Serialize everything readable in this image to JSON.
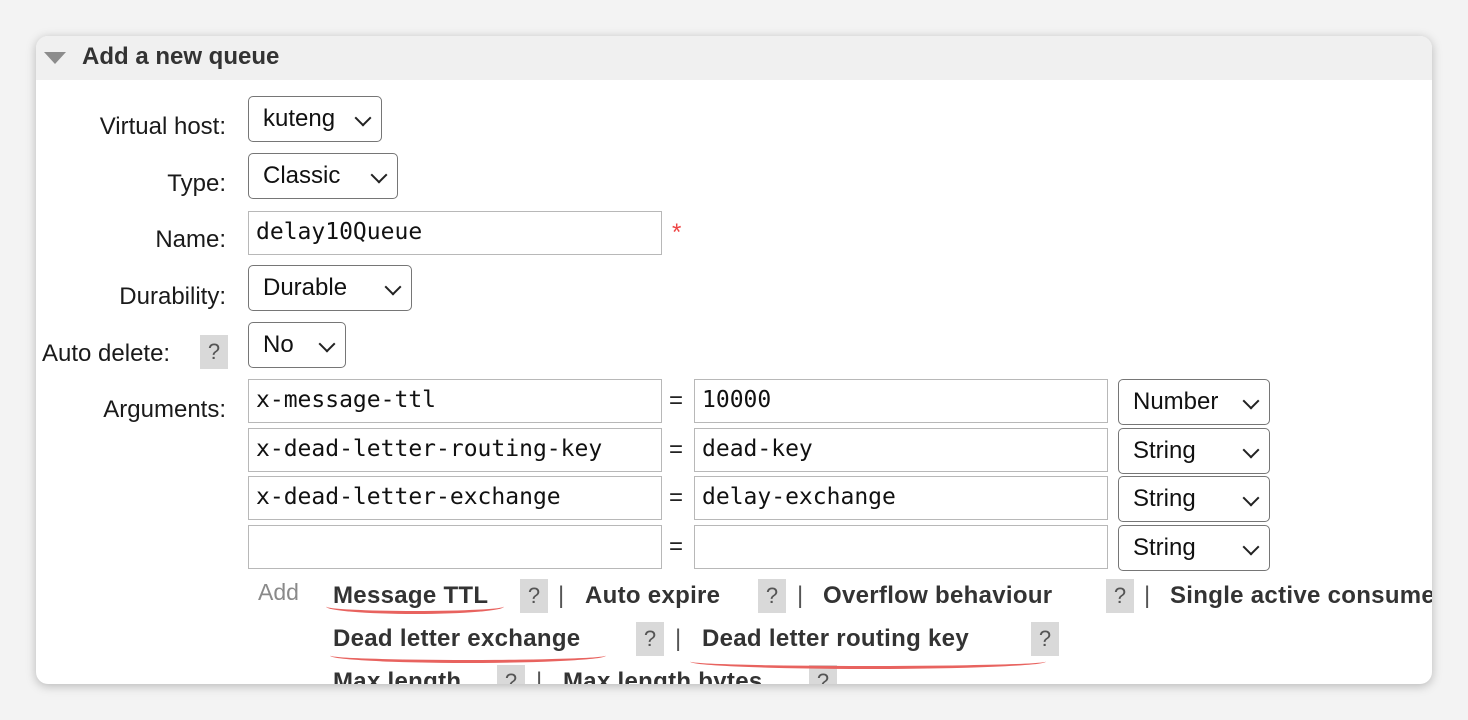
{
  "panel": {
    "title": "Add a new queue"
  },
  "form": {
    "virtual_host": {
      "label": "Virtual host:",
      "value": "kuteng"
    },
    "type": {
      "label": "Type:",
      "value": "Classic"
    },
    "name": {
      "label": "Name:",
      "value": "delay10Queue",
      "required_mark": "*"
    },
    "durability": {
      "label": "Durability:",
      "value": "Durable"
    },
    "auto_delete": {
      "label": "Auto delete:",
      "help": "?",
      "value": "No"
    },
    "arguments": {
      "label": "Arguments:",
      "equals": "=",
      "rows": [
        {
          "key": "x-message-ttl",
          "value": "10000",
          "type": "Number"
        },
        {
          "key": "x-dead-letter-routing-key",
          "value": "dead-key",
          "type": "String"
        },
        {
          "key": "x-dead-letter-exchange",
          "value": "delay-exchange",
          "type": "String"
        },
        {
          "key": "",
          "value": "",
          "type": "String"
        }
      ]
    }
  },
  "add_links": {
    "add_label": "Add",
    "separator": "|",
    "help": "?",
    "items": [
      "Message TTL",
      "Auto expire",
      "Overflow behaviour",
      "Single active consumer",
      "Dead letter exchange",
      "Dead letter routing key",
      "Max length",
      "Max length bytes"
    ]
  },
  "colors": {
    "highlight_underline": "#e8635f",
    "required": "#ee4444"
  }
}
